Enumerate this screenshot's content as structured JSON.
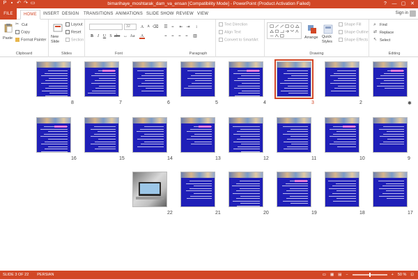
{
  "window": {
    "title": "bimarihaye_moshtarak_dam_va_ensan [Compatibility Mode] - PowerPoint (Product Activation Failed)",
    "controls": [
      "?",
      "—",
      "▢",
      "✕"
    ]
  },
  "tabs": [
    {
      "label": "FILE"
    },
    {
      "label": "HOME"
    },
    {
      "label": "INSERT"
    },
    {
      "label": "DESIGN"
    },
    {
      "label": "TRANSITIONS"
    },
    {
      "label": "ANIMATIONS"
    },
    {
      "label": "SLIDE SHOW"
    },
    {
      "label": "REVIEW"
    },
    {
      "label": "VIEW"
    }
  ],
  "active_tab": "HOME",
  "signin": "Sign in",
  "ribbon": {
    "clipboard": {
      "paste": "Paste",
      "cut": "Cut",
      "copy": "Copy",
      "format_painter": "Format Painter",
      "label": "Clipboard"
    },
    "slides": {
      "new_slide": "New Slide",
      "layout": "Layout",
      "reset": "Reset",
      "section": "Section",
      "label": "Slides"
    },
    "font": {
      "font_name": "",
      "font_size": "32",
      "label": "Font"
    },
    "paragraph": {
      "text_direction": "Text Direction",
      "align_text": "Align Text",
      "convert": "Convert to SmartArt",
      "label": "Paragraph"
    },
    "drawing": {
      "arrange": "Arrange",
      "quick_styles": "Quick Styles",
      "shape_fill": "Shape Fill",
      "shape_outline": "Shape Outline",
      "shape_effects": "Shape Effects",
      "label": "Drawing"
    },
    "editing": {
      "find": "Find",
      "replace": "Replace",
      "select": "Select",
      "label": "Editing"
    }
  },
  "slides": [
    {
      "n": "1",
      "label": "✱"
    },
    {
      "n": "2",
      "label": "2"
    },
    {
      "n": "3",
      "label": "3",
      "selected": true
    },
    {
      "n": "4",
      "label": "4"
    },
    {
      "n": "5",
      "label": "5"
    },
    {
      "n": "6",
      "label": "6"
    },
    {
      "n": "7",
      "label": "7"
    },
    {
      "n": "8",
      "label": "8"
    },
    {
      "n": "9",
      "label": "9"
    },
    {
      "n": "10",
      "label": "10"
    },
    {
      "n": "11",
      "label": "11"
    },
    {
      "n": "12",
      "label": "12"
    },
    {
      "n": "13",
      "label": "13"
    },
    {
      "n": "14",
      "label": "14"
    },
    {
      "n": "15",
      "label": "15"
    },
    {
      "n": "16",
      "label": "16"
    },
    {
      "n": "17",
      "label": "17"
    },
    {
      "n": "18",
      "label": "18"
    },
    {
      "n": "19",
      "label": "19"
    },
    {
      "n": "20",
      "label": "20"
    },
    {
      "n": "21",
      "label": "21"
    },
    {
      "n": "22",
      "label": "22",
      "photo": true
    }
  ],
  "status": {
    "slide_info": "SLIDE 3 OF 22",
    "language": "PERSIAN",
    "zoom": "50 %"
  },
  "colors": {
    "accent": "#d24726",
    "slide_bg": "#1f1fb8",
    "selected_border": "#d24726"
  }
}
